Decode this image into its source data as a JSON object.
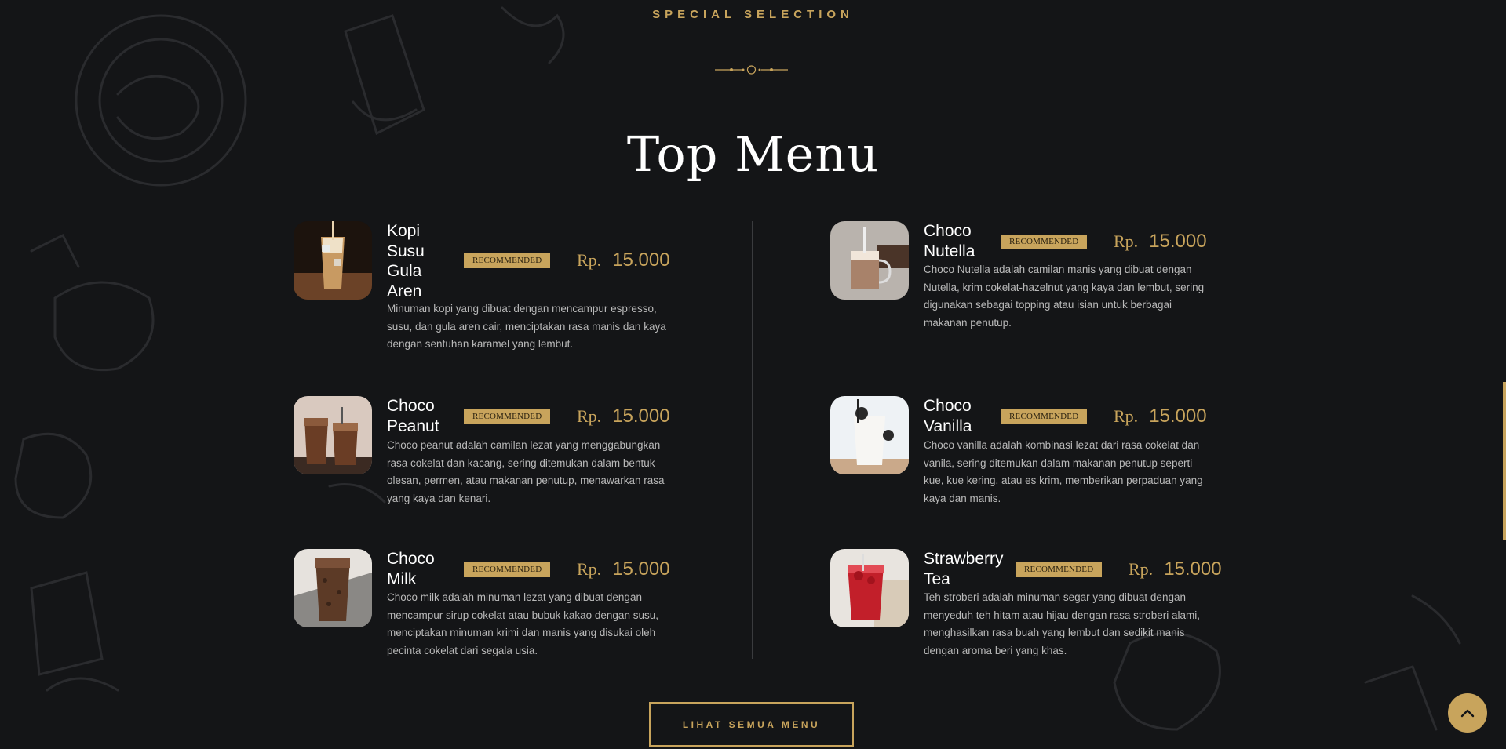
{
  "section": {
    "eyebrow": "SPECIAL SELECTION",
    "title": "Top Menu",
    "cta_label": "LIHAT SEMUA MENU"
  },
  "colors": {
    "accent": "#c8a45c",
    "background": "#141517",
    "description_text": "#b9b9b9"
  },
  "menu": {
    "left": [
      {
        "name": "Kopi Susu Gula Aren",
        "badge": "RECOMMENDED",
        "currency": "Rp.",
        "price": "15.000",
        "description": "Minuman kopi yang dibuat dengan mencampur espresso, susu, dan gula aren cair, menciptakan rasa manis dan kaya dengan sentuhan karamel yang lembut.",
        "image": "iced-coffee-glass"
      },
      {
        "name": "Choco Peanut",
        "badge": "RECOMMENDED",
        "currency": "Rp.",
        "price": "15.000",
        "description": "Choco peanut adalah camilan lezat yang menggabungkan rasa cokelat dan kacang, sering ditemukan dalam bentuk olesan, permen, atau makanan penutup, menawarkan rasa yang kaya dan kenari.",
        "image": "chocolate-drinks"
      },
      {
        "name": "Choco Milk",
        "badge": "RECOMMENDED",
        "currency": "Rp.",
        "price": "15.000",
        "description": "Choco milk adalah minuman lezat yang dibuat dengan mencampur sirup cokelat atau bubuk kakao dengan susu, menciptakan minuman krimi dan manis yang disukai oleh pecinta cokelat dari segala usia.",
        "image": "chocolate-milk-glass"
      }
    ],
    "right": [
      {
        "name": "Choco Nutella",
        "badge": "RECOMMENDED",
        "currency": "Rp.",
        "price": "15.000",
        "description": "Choco Nutella adalah camilan manis yang dibuat dengan Nutella, krim cokelat-hazelnut yang kaya dan lembut, sering digunakan sebagai topping atau isian untuk berbagai makanan penutup.",
        "image": "nutella-jar-drink"
      },
      {
        "name": "Choco Vanilla",
        "badge": "RECOMMENDED",
        "currency": "Rp.",
        "price": "15.000",
        "description": "Choco vanilla adalah kombinasi lezat dari rasa cokelat dan vanila, sering ditemukan dalam makanan penutup seperti kue, kue kering, atau es krim, memberikan perpaduan yang kaya dan manis.",
        "image": "cookies-and-cream-shake"
      },
      {
        "name": "Strawberry Tea",
        "badge": "RECOMMENDED",
        "currency": "Rp.",
        "price": "15.000",
        "description": "Teh stroberi adalah minuman segar yang dibuat dengan menyeduh teh hitam atau hijau dengan rasa stroberi alami, menghasilkan rasa buah yang lembut dan sedikit manis dengan aroma beri yang khas.",
        "image": "strawberry-tea-glass"
      }
    ]
  },
  "icons": {
    "scroll_top": "chevron-up-icon",
    "ornament": "divider-ornament-icon"
  }
}
